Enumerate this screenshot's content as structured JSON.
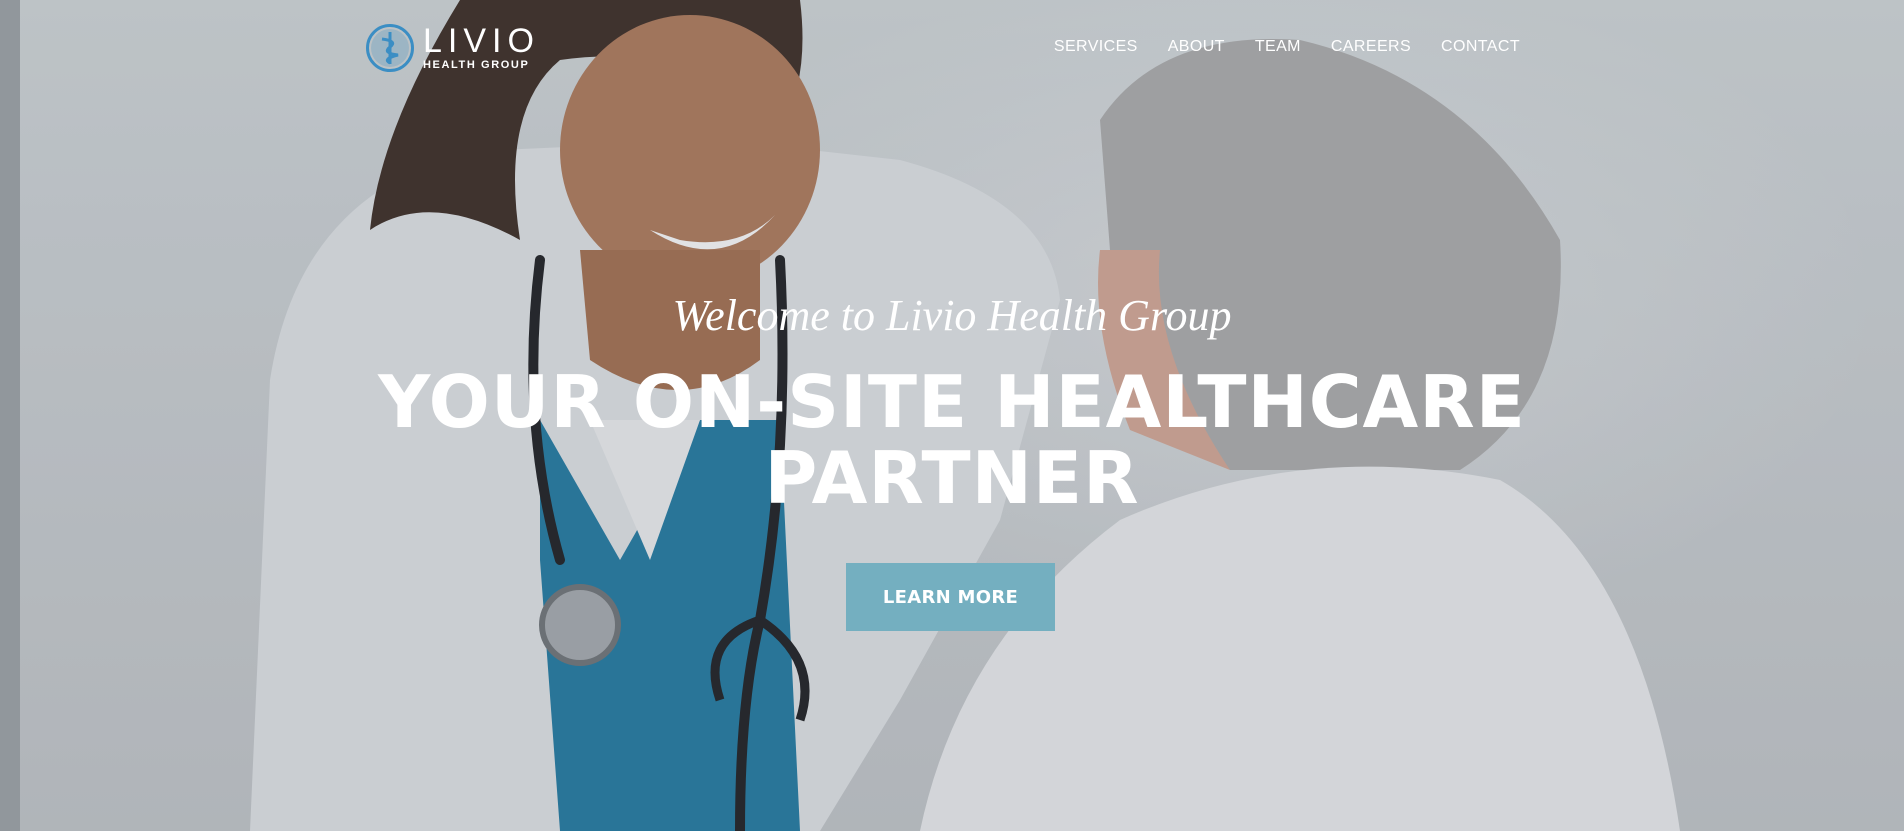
{
  "brand": {
    "name": "LIVIO",
    "tagline": "HEALTH GROUP",
    "accent_color": "#3b8ec4"
  },
  "nav": {
    "items": [
      {
        "label": "SERVICES"
      },
      {
        "label": "ABOUT"
      },
      {
        "label": "TEAM"
      },
      {
        "label": "CAREERS"
      },
      {
        "label": "CONTACT"
      }
    ]
  },
  "hero": {
    "welcome": "Welcome to Livio Health Group",
    "headline_line1": "YOUR ON-SITE HEALTHCARE",
    "headline_line2": "PARTNER",
    "cta_label": "LEARN MORE",
    "cta_color": "#74afc0",
    "background_image": "doctor-with-patient-photo"
  }
}
